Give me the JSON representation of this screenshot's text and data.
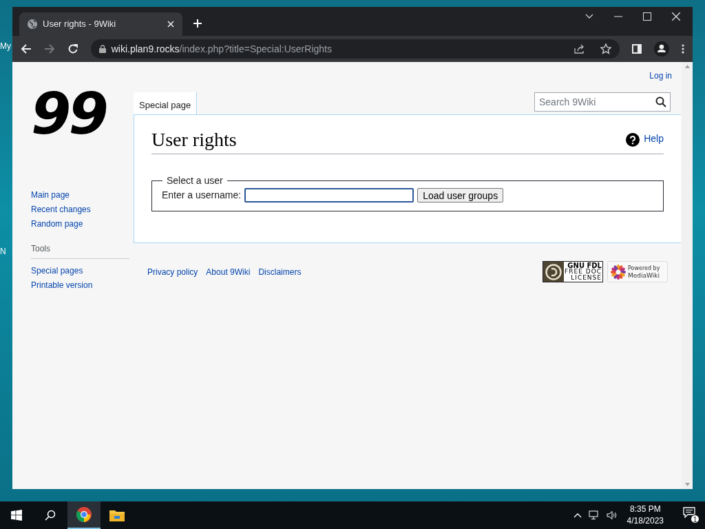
{
  "desktop": {
    "icon_labels": [
      "My",
      "N"
    ]
  },
  "browser": {
    "tabs": [
      {
        "title": "User rights - 9Wiki",
        "selected": true
      }
    ],
    "url": {
      "host": "wiki.plan9.rocks",
      "path": "/index.php?title=Special:UserRights"
    }
  },
  "page": {
    "logo": "99",
    "user_links": [
      "Log in"
    ],
    "nav": [
      "Main page",
      "Recent changes",
      "Random page"
    ],
    "tools": {
      "heading": "Tools",
      "items": [
        "Special pages",
        "Printable version"
      ]
    },
    "tabs": [
      {
        "label": "Special page",
        "selected": true
      }
    ],
    "search": {
      "placeholder": "Search 9Wiki"
    },
    "title": "User rights",
    "help": "Help",
    "form": {
      "legend": "Select a user",
      "label": "Enter a username:",
      "button": "Load user groups"
    },
    "footer_links": [
      "Privacy policy",
      "About 9Wiki",
      "Disclaimers"
    ],
    "badges": [
      {
        "kind": "gnu-fdl",
        "lines": [
          "GNU FDL",
          "FREE DOC",
          "LICENSE"
        ]
      },
      {
        "kind": "mediawiki",
        "lines": [
          "Powered by",
          "MediaWiki"
        ]
      }
    ]
  },
  "taskbar": {
    "apps": [
      {
        "kind": "chrome",
        "selected": true
      },
      {
        "kind": "folder",
        "selected": false
      }
    ],
    "time": "8:35 PM",
    "date": "4/18/2023",
    "notifications": "1"
  }
}
